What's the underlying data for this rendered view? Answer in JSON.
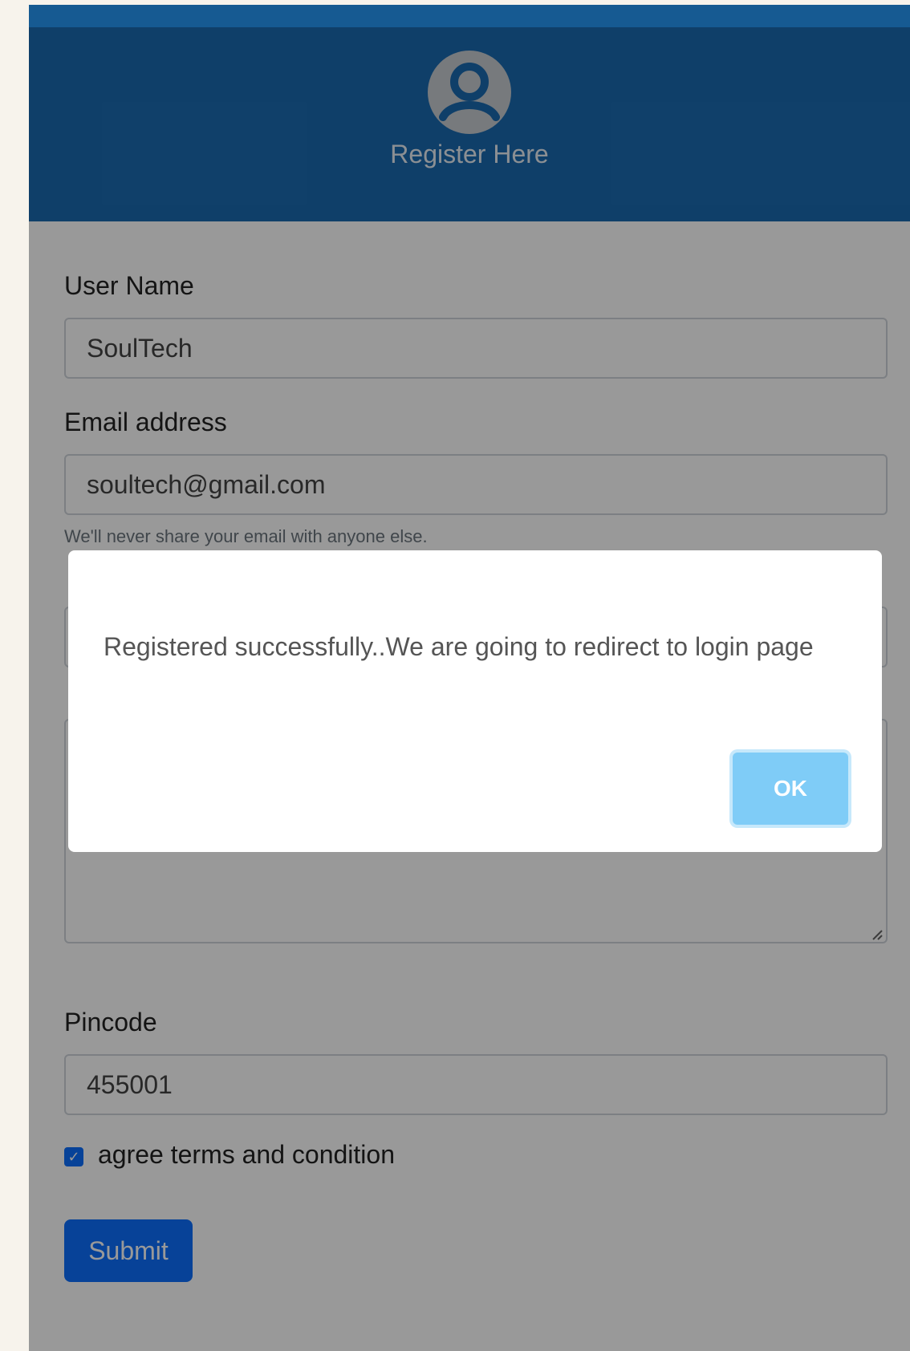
{
  "header": {
    "title": "Register Here",
    "icon": "user-circle-icon",
    "background": "#1a6ab0"
  },
  "form": {
    "username": {
      "label": "User Name",
      "value": "SoulTech"
    },
    "email": {
      "label": "Email address",
      "value": "soultech@gmail.com",
      "help": "We'll never share your email with anyone else."
    },
    "password": {
      "value": ""
    },
    "address": {
      "value": ""
    },
    "pincode": {
      "label": "Pincode",
      "value": "455001"
    },
    "terms": {
      "label": "agree terms and condition",
      "checked": true
    },
    "submit_label": "Submit"
  },
  "modal": {
    "message": "Registered successfully..We are going to redirect to login page",
    "ok_label": "OK"
  },
  "colors": {
    "primary": "#0d6efd",
    "ok_button": "#7fccf7"
  }
}
